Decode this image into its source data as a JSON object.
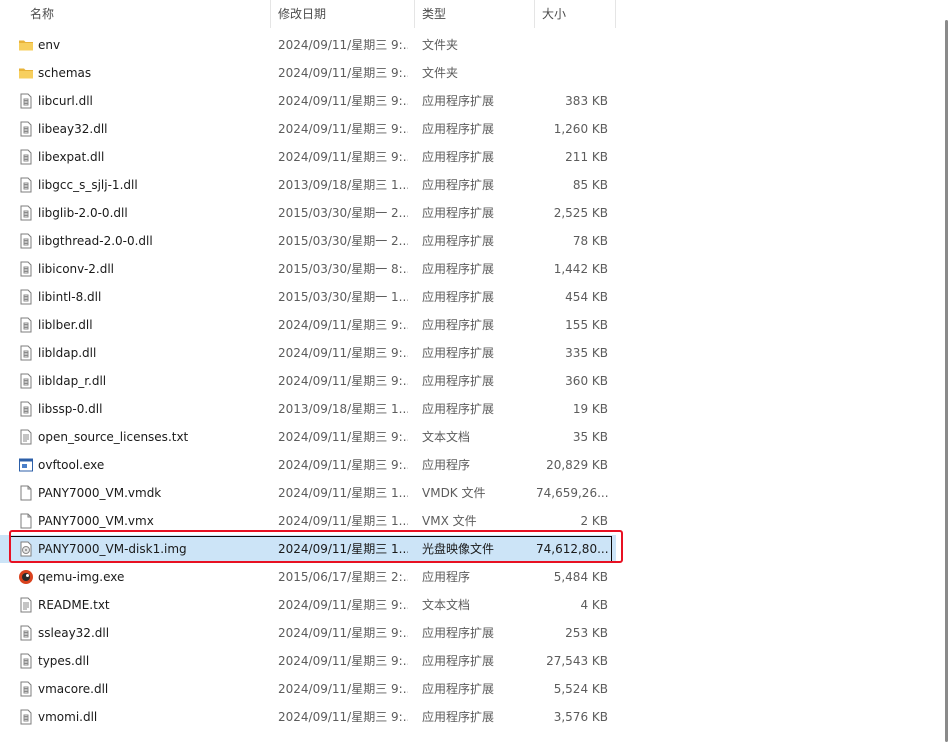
{
  "columns": {
    "name": "名称",
    "date": "修改日期",
    "type": "类型",
    "size": "大小"
  },
  "rows": [
    {
      "name": "env",
      "date": "2024/09/11/星期三 9:...",
      "type": "文件夹",
      "size": "",
      "icon": "folder-icon"
    },
    {
      "name": "schemas",
      "date": "2024/09/11/星期三 9:...",
      "type": "文件夹",
      "size": "",
      "icon": "folder-icon"
    },
    {
      "name": "libcurl.dll",
      "date": "2024/09/11/星期三 9:...",
      "type": "应用程序扩展",
      "size": "383 KB",
      "icon": "dll-file-icon"
    },
    {
      "name": "libeay32.dll",
      "date": "2024/09/11/星期三 9:...",
      "type": "应用程序扩展",
      "size": "1,260 KB",
      "icon": "dll-file-icon"
    },
    {
      "name": "libexpat.dll",
      "date": "2024/09/11/星期三 9:...",
      "type": "应用程序扩展",
      "size": "211 KB",
      "icon": "dll-file-icon"
    },
    {
      "name": "libgcc_s_sjlj-1.dll",
      "date": "2013/09/18/星期三 1...",
      "type": "应用程序扩展",
      "size": "85 KB",
      "icon": "dll-file-icon"
    },
    {
      "name": "libglib-2.0-0.dll",
      "date": "2015/03/30/星期一 2...",
      "type": "应用程序扩展",
      "size": "2,525 KB",
      "icon": "dll-file-icon"
    },
    {
      "name": "libgthread-2.0-0.dll",
      "date": "2015/03/30/星期一 2...",
      "type": "应用程序扩展",
      "size": "78 KB",
      "icon": "dll-file-icon"
    },
    {
      "name": "libiconv-2.dll",
      "date": "2015/03/30/星期一 8:...",
      "type": "应用程序扩展",
      "size": "1,442 KB",
      "icon": "dll-file-icon"
    },
    {
      "name": "libintl-8.dll",
      "date": "2015/03/30/星期一 1...",
      "type": "应用程序扩展",
      "size": "454 KB",
      "icon": "dll-file-icon"
    },
    {
      "name": "liblber.dll",
      "date": "2024/09/11/星期三 9:...",
      "type": "应用程序扩展",
      "size": "155 KB",
      "icon": "dll-file-icon"
    },
    {
      "name": "libldap.dll",
      "date": "2024/09/11/星期三 9:...",
      "type": "应用程序扩展",
      "size": "335 KB",
      "icon": "dll-file-icon"
    },
    {
      "name": "libldap_r.dll",
      "date": "2024/09/11/星期三 9:...",
      "type": "应用程序扩展",
      "size": "360 KB",
      "icon": "dll-file-icon"
    },
    {
      "name": "libssp-0.dll",
      "date": "2013/09/18/星期三 1...",
      "type": "应用程序扩展",
      "size": "19 KB",
      "icon": "dll-file-icon"
    },
    {
      "name": "open_source_licenses.txt",
      "date": "2024/09/11/星期三 9:...",
      "type": "文本文档",
      "size": "35 KB",
      "icon": "text-file-icon"
    },
    {
      "name": "ovftool.exe",
      "date": "2024/09/11/星期三 9:...",
      "type": "应用程序",
      "size": "20,829 KB",
      "icon": "exe-app-icon"
    },
    {
      "name": "PANY7000_VM.vmdk",
      "date": "2024/09/11/星期三 1...",
      "type": "VMDK 文件",
      "size": "74,659,26...",
      "icon": "blank-file-icon"
    },
    {
      "name": "PANY7000_VM.vmx",
      "date": "2024/09/11/星期三 1...",
      "type": "VMX 文件",
      "size": "2 KB",
      "icon": "blank-file-icon"
    },
    {
      "name": "PANY7000_VM-disk1.img",
      "date": "2024/09/11/星期三 1...",
      "type": "光盘映像文件",
      "size": "74,612,80...",
      "icon": "disc-image-icon",
      "selected": true
    },
    {
      "name": "qemu-img.exe",
      "date": "2015/06/17/星期三 2:...",
      "type": "应用程序",
      "size": "5,484 KB",
      "icon": "qemu-app-icon"
    },
    {
      "name": "README.txt",
      "date": "2024/09/11/星期三 9:...",
      "type": "文本文档",
      "size": "4 KB",
      "icon": "text-file-icon"
    },
    {
      "name": "ssleay32.dll",
      "date": "2024/09/11/星期三 9:...",
      "type": "应用程序扩展",
      "size": "253 KB",
      "icon": "dll-file-icon"
    },
    {
      "name": "types.dll",
      "date": "2024/09/11/星期三 9:...",
      "type": "应用程序扩展",
      "size": "27,543 KB",
      "icon": "dll-file-icon"
    },
    {
      "name": "vmacore.dll",
      "date": "2024/09/11/星期三 9:...",
      "type": "应用程序扩展",
      "size": "5,524 KB",
      "icon": "dll-file-icon"
    },
    {
      "name": "vmomi.dll",
      "date": "2024/09/11/星期三 9:...",
      "type": "应用程序扩展",
      "size": "3,576 KB",
      "icon": "dll-file-icon"
    }
  ],
  "colors": {
    "selected_bg": "#cce4f7",
    "highlight_border": "#e81123",
    "folder": "#f2c55c"
  }
}
